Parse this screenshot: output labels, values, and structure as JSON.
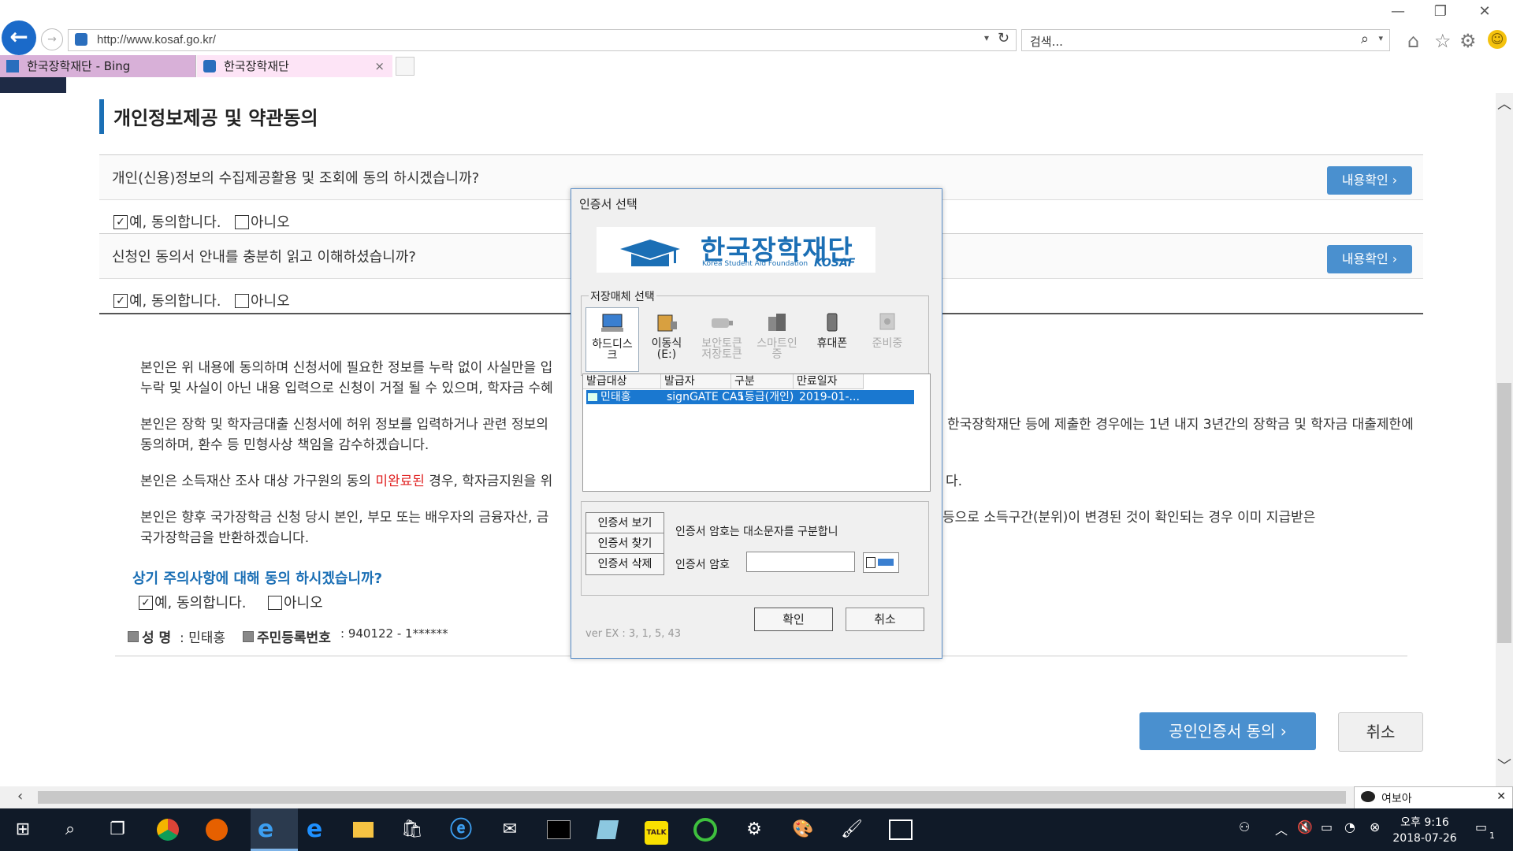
{
  "browser": {
    "url": "http://www.kosaf.go.kr/",
    "search_placeholder": "검색...",
    "tabs": [
      {
        "label": "한국장학재단 - Bing"
      },
      {
        "label": "한국장학재단",
        "close": "×"
      }
    ],
    "window_controls": {
      "minimize": "—",
      "restore": "❐",
      "close": "✕"
    }
  },
  "page": {
    "title": "개인정보제공 및 약관동의",
    "questions": [
      {
        "text": "개인(신용)정보의 수집제공활용 및 조회에 동의 하시겠습니까?",
        "button": "내용확인",
        "yes": "예, 동의합니다.",
        "no": "아니오",
        "yes_checked": true
      },
      {
        "text": "신청인 동의서 안내를 충분히 읽고 이해하셨습니까?",
        "button": "내용확인",
        "yes": "예, 동의합니다.",
        "no": "아니오",
        "yes_checked": true
      }
    ],
    "paragraphs": {
      "p1_line1_left": "본인은 위 내용에 동의하며 신청서에 필요한 정보를 누락 없이 사실만을 입",
      "p1_line2_left": "누락 및 사실이 아닌 내용 입력으로 신청이 거절 될 수 있으며, 학자금 수혜",
      "p2_line1_left": "본인은 장학 및 학자금대출 신청서에 허위 정보를 입력하거나 관련 정보의",
      "p2_line1_right": "한국장학재단 등에 제출한 경우에는 1년 내지 3년간의 장학금 및 학자금 대출제한에",
      "p2_line2": "동의하며, 환수 등 민형사상 책임을 감수하겠습니다.",
      "p3_prefix": "본인은 소득재산 조사 대상 가구원의 동의",
      "p3_red": "미완료된",
      "p3_suffix": "경우, 학자금지원을 위",
      "p3_right": "다.",
      "p4_line1_left": "본인은 향후 국가장학금 신청 당시 본인, 부모 또는 배우자의 금융자산, 금",
      "p4_line1_right": "등으로 소득구간(분위)이 변경된 것이 확인되는 경우 이미 지급받은",
      "p4_line2": "국가장학금을 반환하겠습니다."
    },
    "agree_question": "상기 주의사항에 대해 동의 하시겠습니까?",
    "agree_yes": "예, 동의합니다.",
    "agree_no": "아니오",
    "name_label": "성 명",
    "name_value": ": 민태홍",
    "rrn_label": "주민등록번호",
    "rrn_value": ": 940122 - 1******",
    "btn_cert_agree": "공인인증서 동의",
    "btn_cancel": "취소"
  },
  "dialog": {
    "title": "인증서 선택",
    "logo_kor": "한국장학재단",
    "logo_eng": "Korea Student Aid Foundation",
    "logo_kosaf": "KOSAF",
    "media_legend": "저장매체 선택",
    "media": [
      {
        "line1": "하드디스",
        "line2": "크",
        "state": "selected",
        "icon": "hard-disk-icon"
      },
      {
        "line1": "이동식",
        "line2": "(E:)",
        "state": "enabled",
        "icon": "removable-disk-icon"
      },
      {
        "line1": "보안토큰",
        "line2": "저장토큰",
        "state": "disabled",
        "icon": "security-token-icon"
      },
      {
        "line1": "스마트인",
        "line2": "증",
        "state": "disabled",
        "icon": "smart-cert-icon"
      },
      {
        "line1": "휴대폰",
        "line2": "",
        "state": "enabled",
        "icon": "mobile-phone-icon"
      },
      {
        "line1": "준비중",
        "line2": "",
        "state": "disabled",
        "icon": "pending-icon"
      }
    ],
    "table_headers": [
      "발급대상",
      "발급자",
      "구분",
      "만료일자"
    ],
    "table_rows": [
      {
        "subject": "민태홍",
        "issuer": "signGATE CA5",
        "type": "1등급(개인)",
        "expiry": "2019-01-..."
      }
    ],
    "btn_view": "인증서 보기",
    "btn_find": "인증서 찾기",
    "btn_delete": "인증서 삭제",
    "pw_note": "인증서 암호는 대소문자를 구분합니",
    "pw_label": "인증서 암호",
    "btn_ok": "확인",
    "btn_cancel": "취소",
    "version": "ver EX : 3, 1, 5, 43"
  },
  "chat_popup": {
    "label": "여보아",
    "close": "✕"
  },
  "taskbar": {
    "clock_time": "오후 9:16",
    "clock_date": "2018-07-26",
    "notification_count": "1",
    "apps": [
      "start-icon",
      "search-icon",
      "task-view-icon",
      "chrome-icon",
      "firefox-icon",
      "ie-icon",
      "edge-icon",
      "file-explorer-icon",
      "store-icon",
      "ie-blue-icon",
      "mail-icon",
      "terminal-icon",
      "notes-icon",
      "kakaotalk-icon",
      "green-app-icon",
      "settings-icon",
      "paint-icon",
      "paint2-icon",
      "photos-icon"
    ],
    "kakao_label": "TALK"
  },
  "colors": {
    "accent": "#4a90cf",
    "title_bar": "#1b6fb5",
    "selection": "#1a78d0",
    "warning_red": "#e02020"
  }
}
